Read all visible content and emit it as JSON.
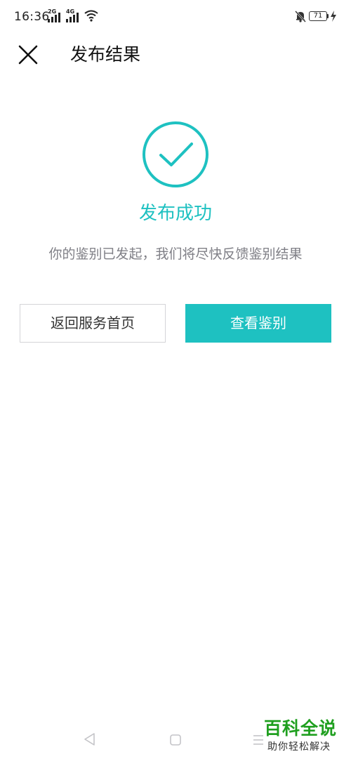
{
  "status_bar": {
    "time": "16:36",
    "signal_1": "2G",
    "signal_2": "4G",
    "battery": "71",
    "icons": [
      "signal-2g-icon",
      "signal-4g-icon",
      "wifi-icon",
      "bell-muted-icon",
      "battery-icon",
      "charging-bolt-icon"
    ]
  },
  "header": {
    "title": "发布结果",
    "close_icon": "close-icon"
  },
  "result": {
    "icon": "check-circle-icon",
    "title": "发布成功",
    "description": "你的鉴别已发起，我们将尽快反馈鉴别结果"
  },
  "actions": {
    "home_label": "返回服务首页",
    "view_label": "查看鉴别"
  },
  "nav_bar": {
    "icons": [
      "nav-back-icon",
      "nav-home-icon",
      "nav-menu-icon"
    ]
  },
  "watermark": {
    "title": "百科全说",
    "subtitle": "助你轻松解决"
  },
  "colors": {
    "accent": "#1ec1c1",
    "text_secondary": "#7f7f86",
    "border": "#d4d4d8",
    "watermark": "#1f9f1f"
  }
}
